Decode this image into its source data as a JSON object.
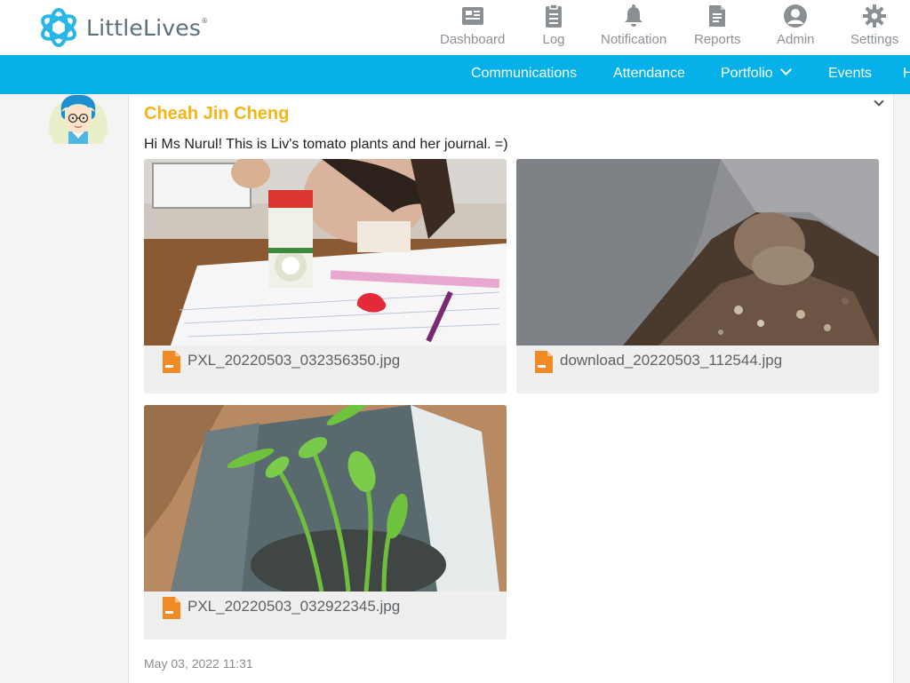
{
  "brand": {
    "name": "LittleLives",
    "mark": "®"
  },
  "topnav": [
    {
      "label": "Dashboard",
      "icon": "dashboard-icon"
    },
    {
      "label": "Log",
      "icon": "clipboard-icon"
    },
    {
      "label": "Notification",
      "icon": "bell-icon"
    },
    {
      "label": "Reports",
      "icon": "report-icon"
    },
    {
      "label": "Admin",
      "icon": "user-circle-icon"
    },
    {
      "label": "Settings",
      "icon": "gear-icon"
    }
  ],
  "subnav": [
    {
      "label": "Communications"
    },
    {
      "label": "Attendance"
    },
    {
      "label": "Portfolio"
    },
    {
      "label": "Events"
    },
    {
      "label": "H"
    }
  ],
  "post": {
    "author": "Cheah Jin Cheng",
    "message": "Hi Ms Nurul! This is Liv's tomato plants and her journal. =)",
    "timestamp": "May 03, 2022 11:31",
    "attachments": [
      {
        "filename": "PXL_20220503_032356350.jpg",
        "file_icon": "image-file-icon"
      },
      {
        "filename": "download_20220503_112544.jpg",
        "file_icon": "image-file-icon"
      },
      {
        "filename": "PXL_20220503_032922345.jpg",
        "file_icon": "image-file-icon"
      }
    ]
  },
  "colors": {
    "accent_blue": "#05b1e8",
    "author_yellow": "#f3b51a",
    "file_orange": "#f08a24"
  }
}
